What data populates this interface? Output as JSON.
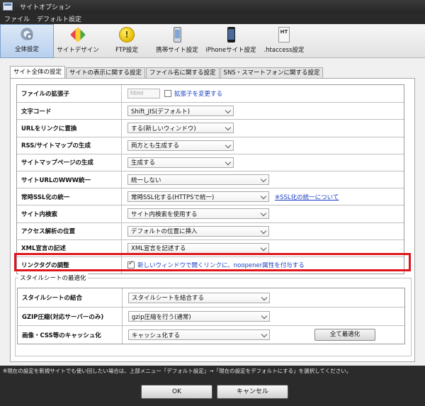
{
  "window": {
    "title": "サイトオプション"
  },
  "menu": [
    "ファイル",
    "デフォルト設定"
  ],
  "toolbar": [
    {
      "label": "全体設定",
      "icon": "gear-icon",
      "active": true
    },
    {
      "label": "サイトデザイン",
      "icon": "design-icon"
    },
    {
      "label": "FTP設定",
      "icon": "ftp-icon"
    },
    {
      "label": "携帯サイト設定",
      "icon": "mobile-icon"
    },
    {
      "label": "iPhoneサイト設定",
      "icon": "iphone-icon"
    },
    {
      "label": ".htaccess設定",
      "icon": "htaccess-icon"
    }
  ],
  "tabs": [
    "サイト全体の設定",
    "サイトの表示に関する設定",
    "ファイル名に関する設定",
    "SNS・スマートフォンに関する設定"
  ],
  "settings": {
    "ext": {
      "label": "ファイルの拡張子",
      "value": "html",
      "checkbox_label": "拡張子を変更する",
      "checked": false
    },
    "charset": {
      "label": "文字コード",
      "value": "Shift_JIS(デフォルト)"
    },
    "url_link": {
      "label": "URLをリンクに置換",
      "value": "する(新しいウィンドウ)"
    },
    "rss": {
      "label": "RSS/サイトマップの生成",
      "value": "両方とも生成する"
    },
    "sitemap_page": {
      "label": "サイトマップページの生成",
      "value": "生成する"
    },
    "www": {
      "label": "サイトURLのWWW統一",
      "value": "統一しない"
    },
    "ssl": {
      "label": "常時SSL化の統一",
      "value": "常時SSL化する(HTTPSで統一)",
      "link": "※SSL化の統一について"
    },
    "search": {
      "label": "サイト内検索",
      "value": "サイト内検索を使用する"
    },
    "analytics": {
      "label": "アクセス解析の位置",
      "value": "デフォルトの位置に挿入"
    },
    "xml": {
      "label": "XML宣言の記述",
      "value": "XML宣言を記述する"
    },
    "link_tag": {
      "label": "リンクタグの調整",
      "checkbox_label": "新しいウィンドウで開くリンクに、noopener属性を付与する",
      "checked": true
    }
  },
  "stylesheet": {
    "legend": "スタイルシートの最適化",
    "combine": {
      "label": "スタイルシートの結合",
      "value": "スタイルシートを結合する"
    },
    "gzip": {
      "label": "GZIP圧縮(対応サーバーのみ)",
      "value": "gzip圧縮を行う(通常)"
    },
    "cache": {
      "label": "画像・CSS等のキャッシュ化",
      "value": "キャッシュ化する"
    },
    "optimize_button": "全て最適化"
  },
  "footer": {
    "note": "※現在の設定を新規サイトでも使い回したい場合は、上部メニュー「デフォルト設定」→「現在の設定をデフォルトにする」を選択してください。",
    "ok": "OK",
    "cancel": "キャンセル"
  },
  "colors": {
    "highlight": "#e0151c",
    "link": "#1a3fc1"
  }
}
